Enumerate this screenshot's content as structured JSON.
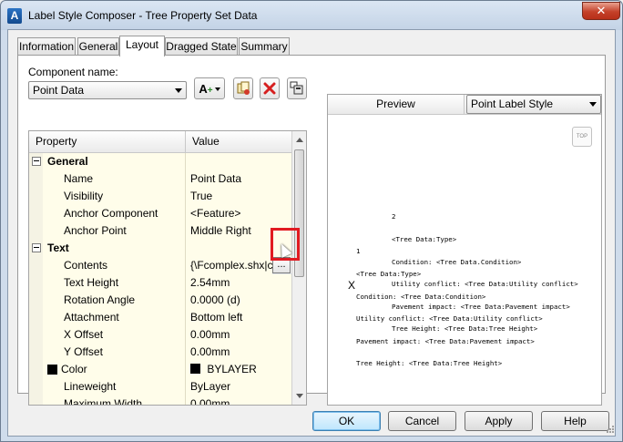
{
  "window": {
    "title": "Label Style Composer - Tree Property Set Data",
    "close_glyph": "✕",
    "app_icon_letter": "A"
  },
  "tabs": [
    {
      "label": "Information"
    },
    {
      "label": "General"
    },
    {
      "label": "Layout",
      "active": true
    },
    {
      "label": "Dragged State"
    },
    {
      "label": "Summary"
    }
  ],
  "component": {
    "label": "Component name:",
    "selected": "Point Data"
  },
  "toolbar": {
    "add_icon": "add-component-icon",
    "copy_icon": "copy-component-icon",
    "delete_icon": "delete-component-icon",
    "draw_order_icon": "draw-order-icon"
  },
  "grid": {
    "headers": {
      "property": "Property",
      "value": "Value"
    },
    "general": {
      "category": "General",
      "name": {
        "label": "Name",
        "value": "Point Data"
      },
      "visibility": {
        "label": "Visibility",
        "value": "True"
      },
      "anchor_component": {
        "label": "Anchor Component",
        "value": "<Feature>"
      },
      "anchor_point": {
        "label": "Anchor Point",
        "value": "Middle Right"
      }
    },
    "text": {
      "category": "Text",
      "contents": {
        "label": "Contents",
        "value": "{\\Fcomplex.shx|c"
      },
      "text_height": {
        "label": "Text Height",
        "value": "2.54mm"
      },
      "rotation_angle": {
        "label": "Rotation Angle",
        "value": "0.0000 (d)"
      },
      "attachment": {
        "label": "Attachment",
        "value": "Bottom left"
      },
      "x_offset": {
        "label": "X Offset",
        "value": "0.00mm"
      },
      "y_offset": {
        "label": "Y Offset",
        "value": "0.00mm"
      },
      "color": {
        "label": "Color",
        "value": "BYLAYER",
        "swatch": "#000000"
      },
      "lineweight": {
        "label": "Lineweight",
        "value": "ByLayer"
      },
      "maximum_width": {
        "label": "Maximum Width",
        "value": "0.00mm"
      }
    },
    "ellipsis": "..."
  },
  "preview": {
    "title": "Preview",
    "style_selected": "Point Label Style",
    "viewcube": "TOP",
    "label_upper": [
      "2",
      "<Tree Data:Type>",
      "Condition: <Tree Data.Condition>",
      "Utility conflict: <Tree Data:Utility conflict>",
      "Pavement impact: <Tree Data:Pavement impact>",
      "Tree Height: <Tree Data:Tree Height>"
    ],
    "label_lower": [
      "1",
      "<Tree Data:Type>",
      "Condition: <Tree Data:Condition>",
      "Utility conflict: <Tree Data:Utility conflict>",
      "Pavement impact: <Tree Data:Pavement impact>",
      "Tree Height: <Tree Data:Tree Height>"
    ],
    "point_marker": "X"
  },
  "buttons": {
    "ok": "OK",
    "cancel": "Cancel",
    "apply": "Apply",
    "help": "Help"
  },
  "colors": {
    "highlight": "#e11b22",
    "row_bg": "#fffdea",
    "title_bg": "#cfdceb"
  }
}
